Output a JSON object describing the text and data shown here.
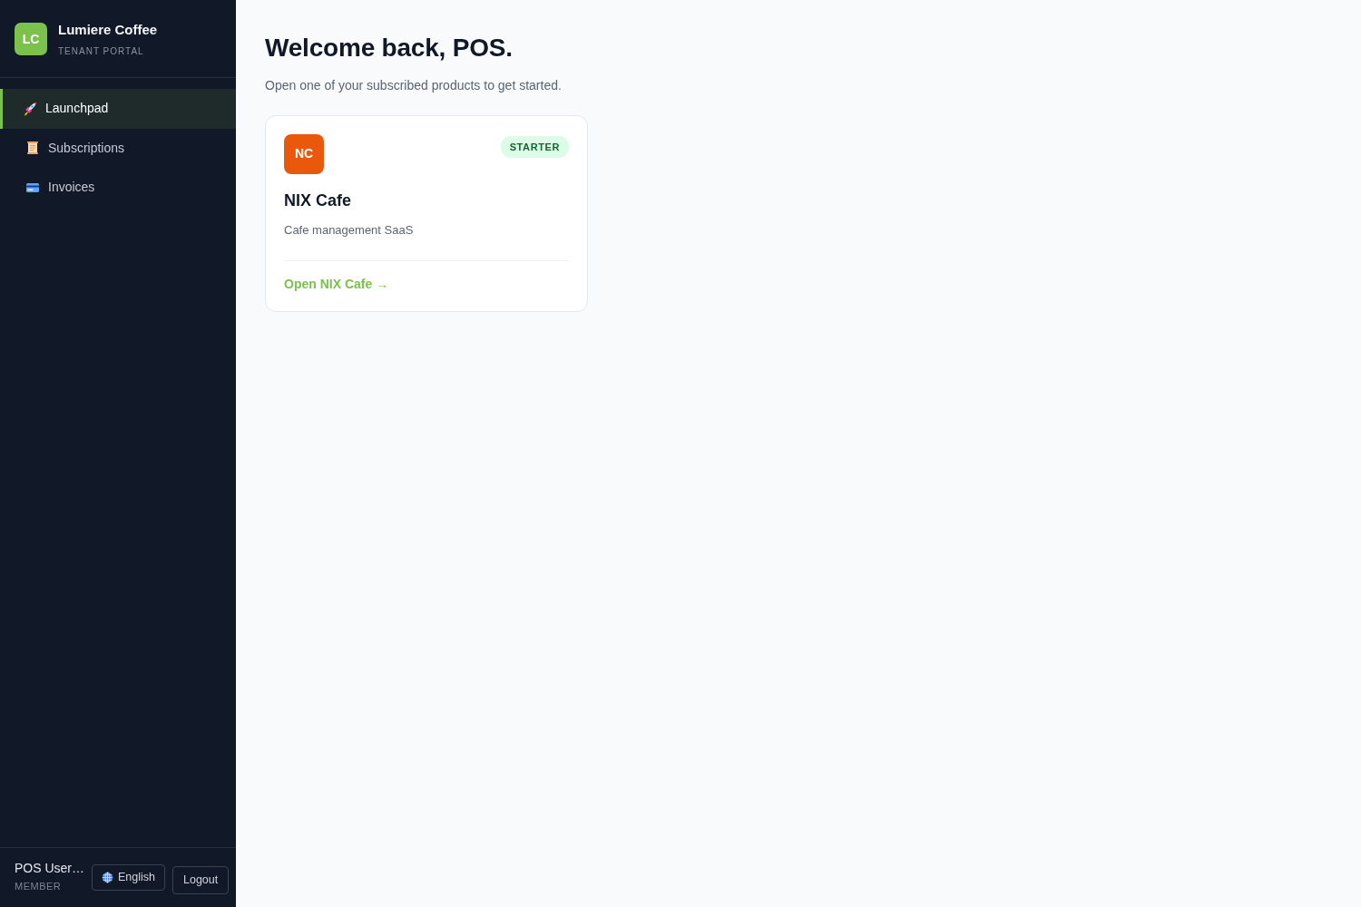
{
  "brand": {
    "initials": "LC",
    "name": "Lumiere Coffee",
    "subtitle": "TENANT PORTAL"
  },
  "nav": [
    {
      "label": "Launchpad",
      "selected": true
    },
    {
      "label": "Subscriptions",
      "selected": false
    },
    {
      "label": "Invoices",
      "selected": false
    }
  ],
  "user": {
    "name": "POS User…",
    "role": "MEMBER"
  },
  "language_button": "English",
  "logout_button": "Logout",
  "header": {
    "title": "Welcome back, POS.",
    "subtitle": "Open one of your subscribed products to get started."
  },
  "products": [
    {
      "initials": "NC",
      "color": "#ea580c",
      "plan": "STARTER",
      "name": "NIX Cafe",
      "description": "Cafe management SaaS",
      "link": "Open NIX Cafe →"
    }
  ]
}
